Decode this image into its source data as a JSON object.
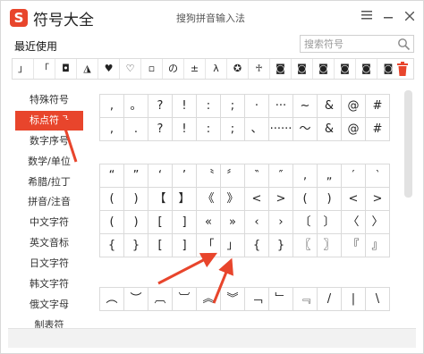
{
  "titlebar": {
    "logo": "S",
    "app_title": "符号大全",
    "window_title": "搜狗拼音输入法",
    "menu_icon": "hamburger-icon",
    "minimize_icon": "minimize-icon",
    "close_icon": "close-icon"
  },
  "recent": {
    "label": "最近使用",
    "items": [
      "」",
      "「",
      "◘",
      "◮",
      "♥",
      "♡",
      "▫",
      "の",
      "±",
      "λ",
      "✪",
      "♱",
      "◙",
      "◙",
      "◙",
      "◙",
      "◙",
      "◙"
    ]
  },
  "search": {
    "placeholder": "搜索符号"
  },
  "categories": [
    {
      "label": "特殊符号",
      "active": false
    },
    {
      "label": "标点符号",
      "active": true
    },
    {
      "label": "数字序号",
      "active": false
    },
    {
      "label": "数学/单位",
      "active": false
    },
    {
      "label": "希腊/拉丁",
      "active": false
    },
    {
      "label": "拼音/注音",
      "active": false
    },
    {
      "label": "中文字符",
      "active": false
    },
    {
      "label": "英文音标",
      "active": false
    },
    {
      "label": "日文字符",
      "active": false
    },
    {
      "label": "韩文字符",
      "active": false
    },
    {
      "label": "俄文字母",
      "active": false
    },
    {
      "label": "制表符",
      "active": false
    }
  ],
  "symbol_sections": [
    [
      [
        ",",
        "。",
        "?",
        "!",
        ":",
        ";",
        "·",
        "···",
        "~",
        "&",
        "@",
        "#"
      ],
      [
        ",",
        ".",
        "?",
        "!",
        ":",
        ";",
        "、",
        "······",
        "～",
        "&",
        "@",
        "#"
      ]
    ],
    [
      [
        "“",
        "”",
        "‘",
        "’",
        "〝",
        "〞",
        "‶",
        "″",
        "‚",
        "„",
        "′",
        "‵"
      ],
      [
        "(",
        ")",
        "【",
        "】",
        "《",
        "》",
        "<",
        ">",
        "(",
        ")",
        "<",
        ">"
      ],
      [
        "(",
        ")",
        "[",
        "]",
        "«",
        "»",
        "‹",
        "›",
        "〔",
        "〕",
        "〈",
        "〉"
      ],
      [
        "{",
        "}",
        "[",
        "]",
        "「",
        "」",
        "{",
        "}",
        "〖",
        "〗",
        "『",
        "』"
      ]
    ],
    [
      [
        "︵",
        "︶",
        "︹",
        "︺",
        "︽",
        "︾",
        "﹁",
        "﹂",
        "﹃",
        "/",
        "|",
        "\\"
      ]
    ]
  ],
  "colors": {
    "accent": "#e8452c",
    "arrow": "#e8452c"
  }
}
